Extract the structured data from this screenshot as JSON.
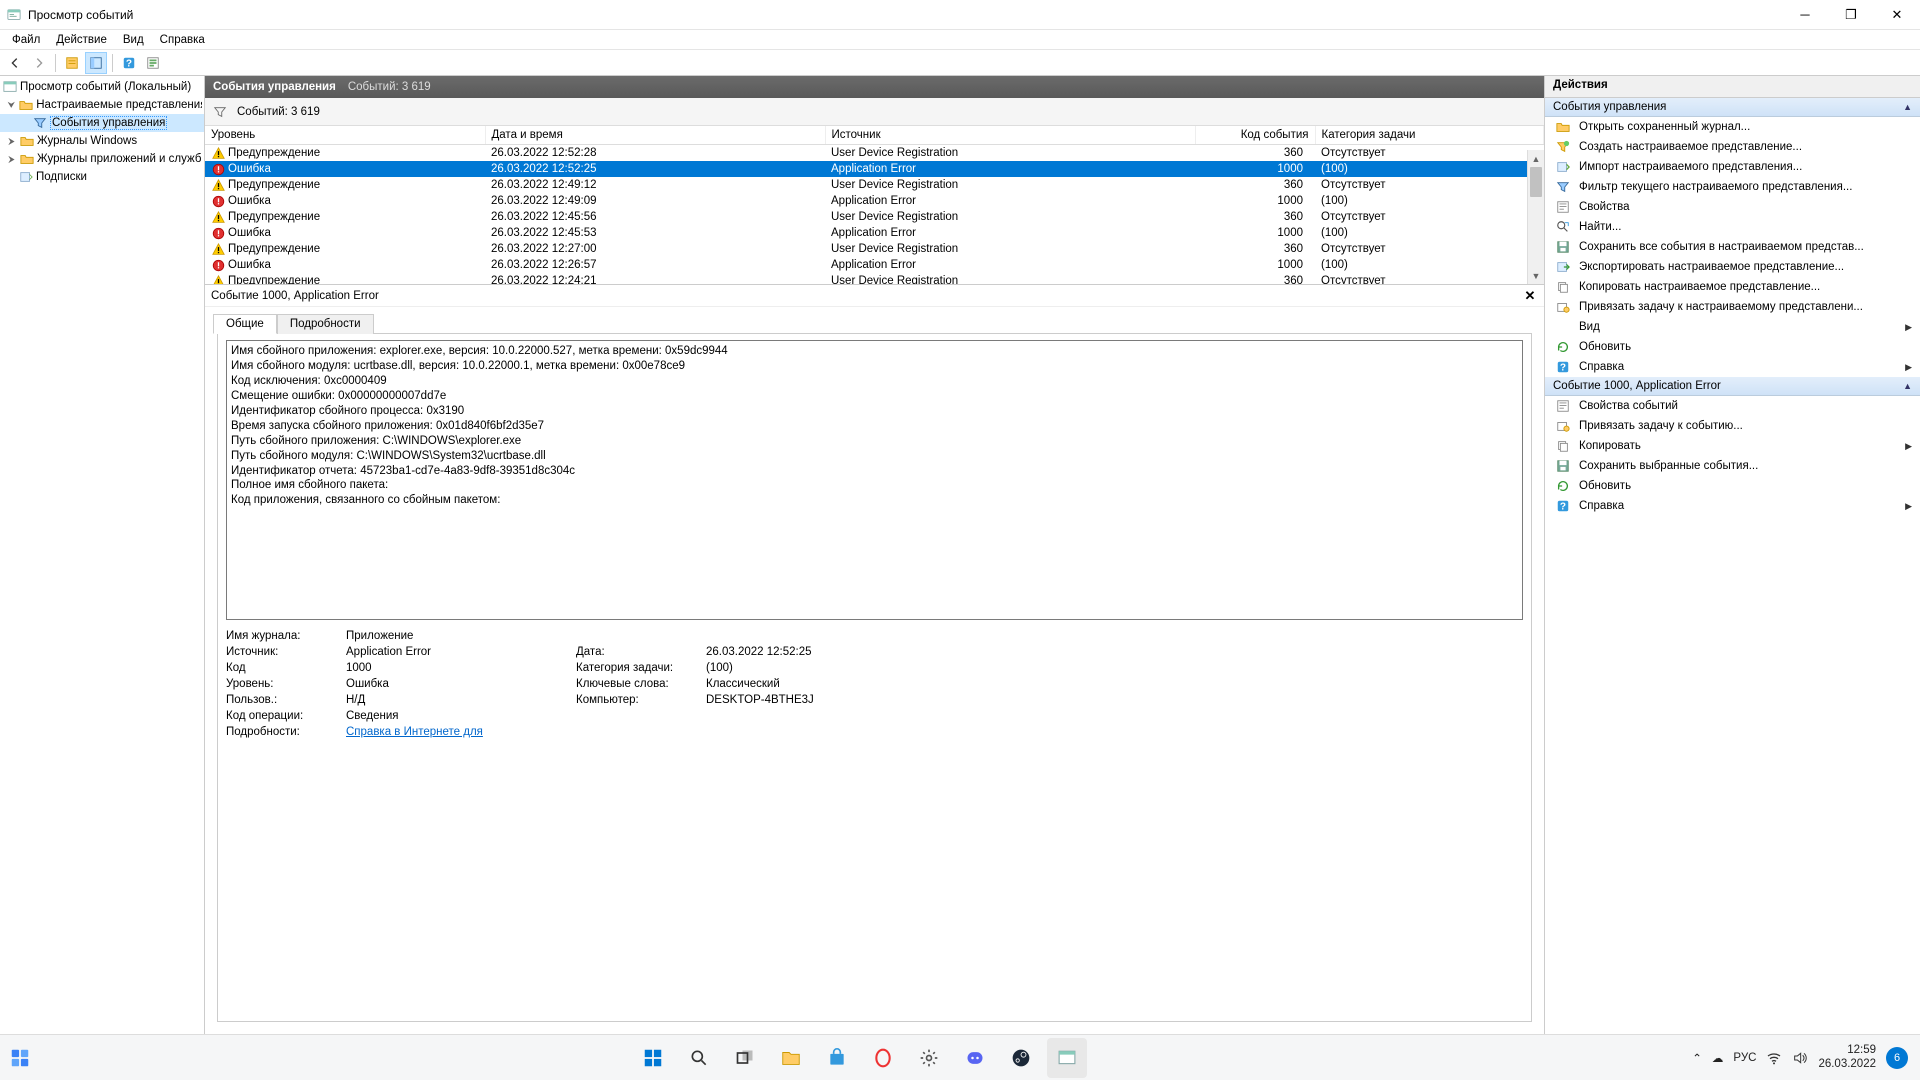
{
  "window": {
    "title": "Просмотр событий"
  },
  "menubar": [
    "Файл",
    "Действие",
    "Вид",
    "Справка"
  ],
  "tree": {
    "root": "Просмотр событий (Локальный)",
    "custom_views": "Настраиваемые представления",
    "admin_events": "События управления",
    "win_logs": "Журналы Windows",
    "app_logs": "Журналы приложений и служб",
    "subscriptions": "Подписки"
  },
  "center": {
    "title": "События управления",
    "count_label": "Событий: 3 619",
    "filter_label": "Событий: 3 619",
    "columns": {
      "level": "Уровень",
      "datetime": "Дата и время",
      "source": "Источник",
      "event_id": "Код события",
      "task_category": "Категория задачи"
    },
    "rows": [
      {
        "level": "Предупреждение",
        "dt": "26.03.2022 12:52:28",
        "src": "User Device Registration",
        "id": "360",
        "cat": "Отсутствует",
        "type": "warn"
      },
      {
        "level": "Ошибка",
        "dt": "26.03.2022 12:52:25",
        "src": "Application Error",
        "id": "1000",
        "cat": "(100)",
        "type": "error",
        "selected": true
      },
      {
        "level": "Предупреждение",
        "dt": "26.03.2022 12:49:12",
        "src": "User Device Registration",
        "id": "360",
        "cat": "Отсутствует",
        "type": "warn"
      },
      {
        "level": "Ошибка",
        "dt": "26.03.2022 12:49:09",
        "src": "Application Error",
        "id": "1000",
        "cat": "(100)",
        "type": "error"
      },
      {
        "level": "Предупреждение",
        "dt": "26.03.2022 12:45:56",
        "src": "User Device Registration",
        "id": "360",
        "cat": "Отсутствует",
        "type": "warn"
      },
      {
        "level": "Ошибка",
        "dt": "26.03.2022 12:45:53",
        "src": "Application Error",
        "id": "1000",
        "cat": "(100)",
        "type": "error"
      },
      {
        "level": "Предупреждение",
        "dt": "26.03.2022 12:27:00",
        "src": "User Device Registration",
        "id": "360",
        "cat": "Отсутствует",
        "type": "warn"
      },
      {
        "level": "Ошибка",
        "dt": "26.03.2022 12:26:57",
        "src": "Application Error",
        "id": "1000",
        "cat": "(100)",
        "type": "error"
      },
      {
        "level": "Предупреждение",
        "dt": "26.03.2022 12:24:21",
        "src": "User Device Registration",
        "id": "360",
        "cat": "Отсутствует",
        "type": "warn"
      }
    ]
  },
  "detail": {
    "header": "Событие 1000, Application Error",
    "tabs": {
      "general": "Общие",
      "details": "Подробности"
    },
    "body_text": "Имя сбойного приложения: explorer.exe, версия: 10.0.22000.527, метка времени: 0x59dc9944\nИмя сбойного модуля: ucrtbase.dll, версия: 10.0.22000.1, метка времени: 0x00e78ce9\nКод исключения: 0xc0000409\nСмещение ошибки: 0x00000000007dd7e\nИдентификатор сбойного процесса: 0x3190\nВремя запуска сбойного приложения: 0x01d840f6bf2d35e7\nПуть сбойного приложения: C:\\WINDOWS\\explorer.exe\nПуть сбойного модуля: C:\\WINDOWS\\System32\\ucrtbase.dll\nИдентификатор отчета: 45723ba1-cd7e-4a83-9df8-39351d8c304c\nПолное имя сбойного пакета:\nКод приложения, связанного со сбойным пакетом:",
    "meta": {
      "log_label": "Имя журнала:",
      "log": "Приложение",
      "src_label": "Источник:",
      "src": "Application Error",
      "date_label": "Дата:",
      "date": "26.03.2022 12:52:25",
      "code_label": "Код",
      "code": "1000",
      "taskcat_label": "Категория задачи:",
      "taskcat": "(100)",
      "level_label": "Уровень:",
      "level": "Ошибка",
      "keywords_label": "Ключевые слова:",
      "keywords": "Классический",
      "user_label": "Пользов.:",
      "user": "Н/Д",
      "computer_label": "Компьютер:",
      "computer": "DESKTOP-4BTHE3J",
      "opcode_label": "Код операции:",
      "opcode": "Сведения",
      "details_label": "Подробности:",
      "details_link": "Справка в Интернете для "
    }
  },
  "actions": {
    "title": "Действия",
    "section1": "События управления",
    "section2": "Событие 1000, Application Error",
    "items1": [
      {
        "icon": "folder-open",
        "label": "Открыть сохраненный журнал..."
      },
      {
        "icon": "filter-new",
        "label": "Создать настраиваемое представление..."
      },
      {
        "icon": "import",
        "label": "Импорт настраиваемого представления..."
      },
      {
        "icon": "filter",
        "label": "Фильтр текущего настраиваемого представления..."
      },
      {
        "icon": "props",
        "label": "Свойства"
      },
      {
        "icon": "find",
        "label": "Найти..."
      },
      {
        "icon": "save",
        "label": "Сохранить все события в настраиваемом представ..."
      },
      {
        "icon": "export",
        "label": "Экспортировать настраиваемое представление..."
      },
      {
        "icon": "copy",
        "label": "Копировать настраиваемое представление..."
      },
      {
        "icon": "attach",
        "label": "Привязать задачу к настраиваемому представлени..."
      },
      {
        "icon": "view",
        "label": "Вид",
        "submenu": true
      },
      {
        "icon": "refresh",
        "label": "Обновить"
      },
      {
        "icon": "help",
        "label": "Справка",
        "submenu": true
      }
    ],
    "items2": [
      {
        "icon": "props",
        "label": "Свойства событий"
      },
      {
        "icon": "attach",
        "label": "Привязать задачу к событию..."
      },
      {
        "icon": "copy",
        "label": "Копировать",
        "submenu": true
      },
      {
        "icon": "save",
        "label": "Сохранить выбранные события..."
      },
      {
        "icon": "refresh",
        "label": "Обновить"
      },
      {
        "icon": "help",
        "label": "Справка",
        "submenu": true
      }
    ]
  },
  "taskbar": {
    "lang": "РУС",
    "time": "12:59",
    "date": "26.03.2022",
    "notif": "6"
  }
}
